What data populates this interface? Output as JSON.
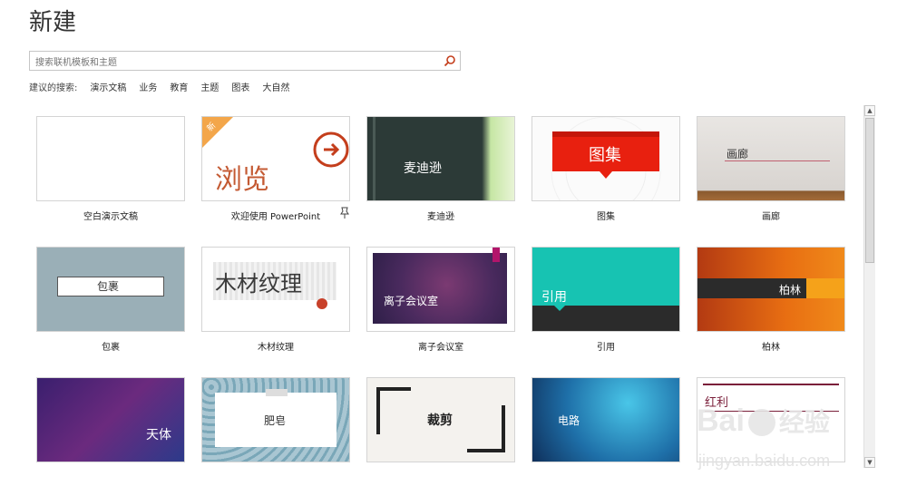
{
  "page": {
    "title": "新建"
  },
  "search": {
    "placeholder": "搜索联机模板和主题"
  },
  "suggested": {
    "prefix": "建议的搜索:",
    "links": [
      "演示文稿",
      "业务",
      "教育",
      "主题",
      "图表",
      "大自然"
    ]
  },
  "templates": [
    {
      "label": "空白演示文稿",
      "thumb_text": ""
    },
    {
      "label": "欢迎使用 PowerPoint",
      "thumb_text": "浏览",
      "badge": "新"
    },
    {
      "label": "麦迪逊",
      "thumb_text": "麦迪逊"
    },
    {
      "label": "图集",
      "thumb_text": "图集"
    },
    {
      "label": "画廊",
      "thumb_text": "画廊"
    },
    {
      "label": "包裹",
      "thumb_text": "包裹"
    },
    {
      "label": "木材纹理",
      "thumb_text": "木材纹理"
    },
    {
      "label": "离子会议室",
      "thumb_text": "离子会议室"
    },
    {
      "label": "引用",
      "thumb_text": "引用"
    },
    {
      "label": "柏林",
      "thumb_text": "柏林"
    },
    {
      "label": "",
      "thumb_text": "天体"
    },
    {
      "label": "",
      "thumb_text": "肥皂"
    },
    {
      "label": "",
      "thumb_text": "裁剪"
    },
    {
      "label": "",
      "thumb_text": "电路"
    },
    {
      "label": "",
      "thumb_text": "红利"
    }
  ],
  "watermark": {
    "brand": "Bai",
    "brand2": "经验",
    "url": "jingyan.baidu.com"
  },
  "colors": {
    "accent": "#c43e1c",
    "red": "#e8200f",
    "teal": "#17c3b2",
    "orange": "#e8750a"
  }
}
